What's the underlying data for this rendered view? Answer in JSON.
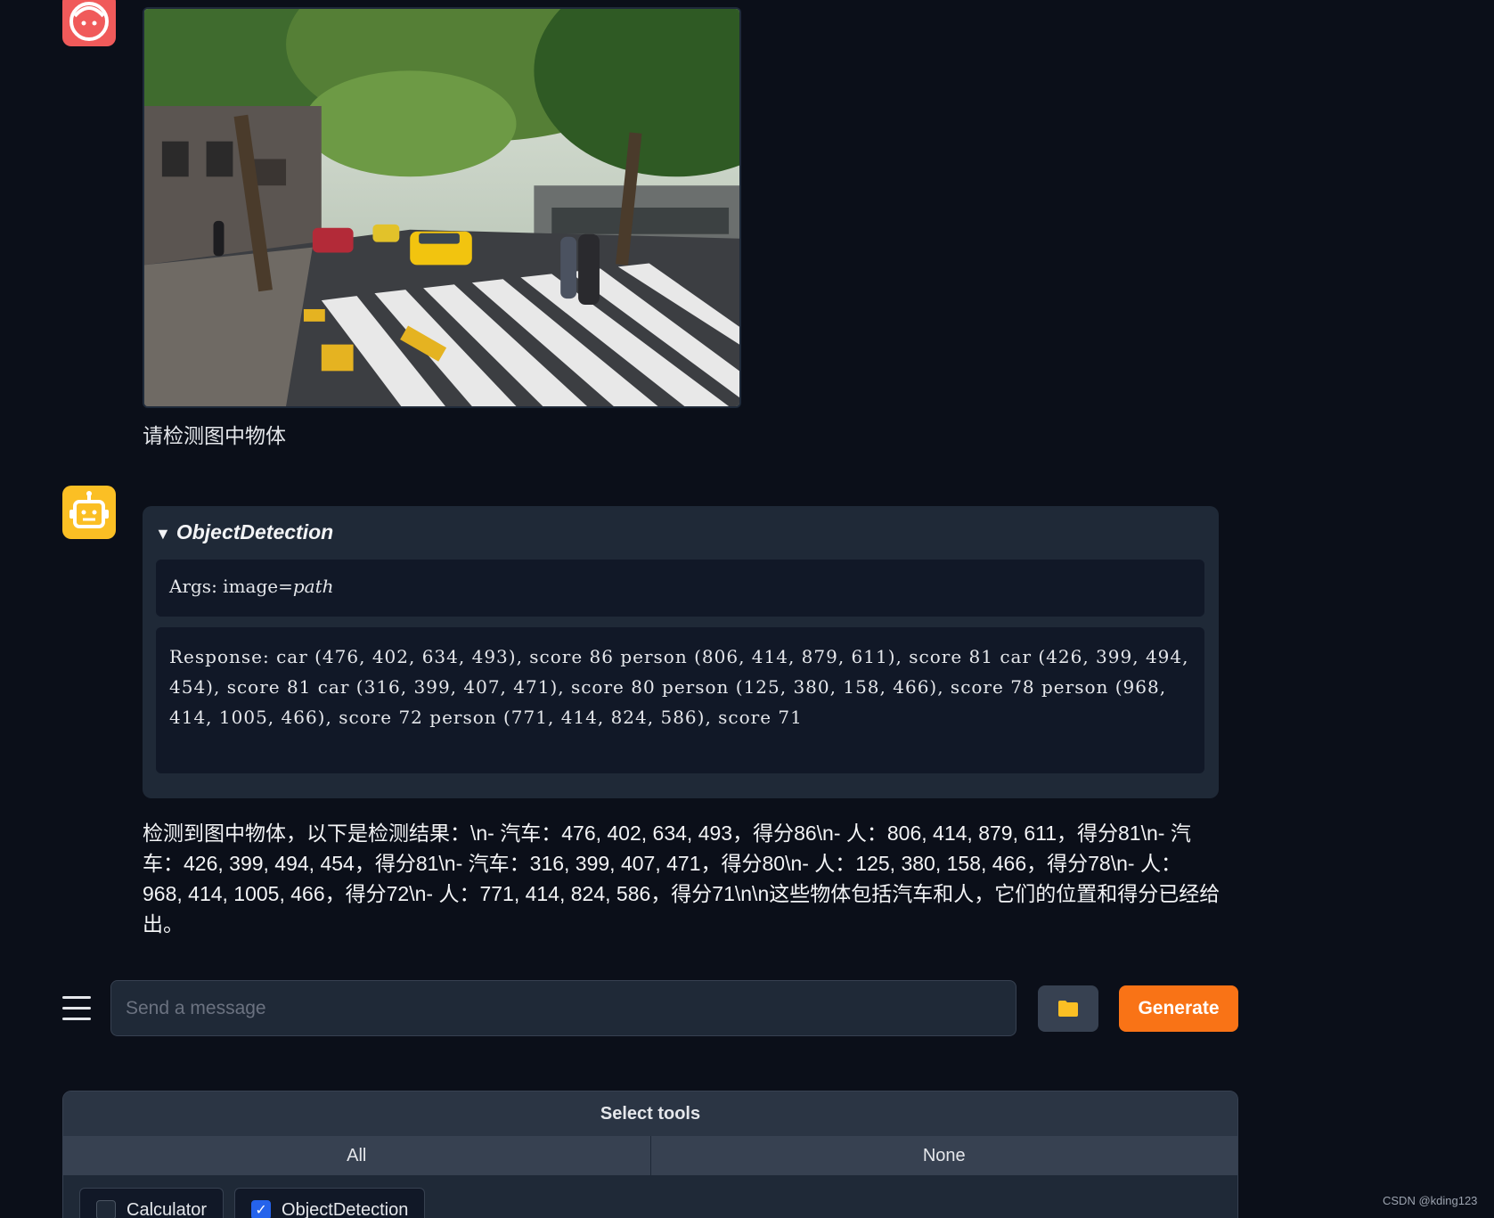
{
  "user_message": {
    "avatar_icon": "user-face-icon",
    "image_alt": "street scene with cars and pedestrians",
    "text": "请检测图中物体"
  },
  "bot_message": {
    "avatar_icon": "robot-icon",
    "tool_call": {
      "title": "ObjectDetection",
      "args_label": "Args: ",
      "args_value_prefix": "image=",
      "args_value_var": "path",
      "response": "Response: car (476, 402, 634, 493), score 86 person (806, 414, 879, 611), score 81 car (426, 399, 494, 454), score 81 car (316, 399, 407, 471), score 80 person (125, 380, 158, 466), score 78 person (968, 414, 1005, 466), score 72 person (771, 414, 824, 586), score 71"
    },
    "text": "检测到图中物体，以下是检测结果：\\n- 汽车：476, 402, 634, 493，得分86\\n- 人：806, 414, 879, 611，得分81\\n- 汽车：426, 399, 494, 454，得分81\\n- 汽车：316, 399, 407, 471，得分80\\n- 人：125, 380, 158, 466，得分78\\n- 人：968, 414, 1005, 466，得分72\\n- 人：771, 414, 824, 586，得分71\\n\\n这些物体包括汽车和人，它们的位置和得分已经给出。"
  },
  "composer": {
    "placeholder": "Send a message",
    "upload_icon": "folder-icon",
    "generate_label": "Generate"
  },
  "tools": {
    "header": "Select tools",
    "all_label": "All",
    "none_label": "None",
    "options": [
      {
        "label": "Calculator",
        "checked": false
      },
      {
        "label": "ObjectDetection",
        "checked": true
      }
    ]
  },
  "watermark": "CSDN @kding123",
  "colors": {
    "background": "#0b0f19",
    "card": "#1f2937",
    "generate": "#f97316",
    "user_avatar": "#f05a5a",
    "bot_avatar": "#fbbf24"
  }
}
